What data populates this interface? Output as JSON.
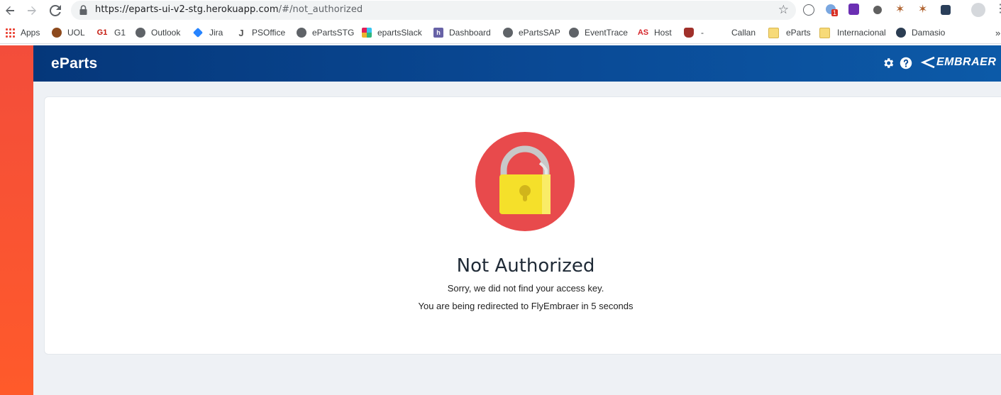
{
  "browser": {
    "url_host": "https://eparts-ui-v2-stg.herokuapp.com",
    "url_path": "/#/not_authorized",
    "bookmarks": [
      {
        "label": "Apps",
        "icon": "apps-grid-icon"
      },
      {
        "label": "UOL",
        "icon": "uol-icon"
      },
      {
        "label": "G1",
        "icon": "g1-icon"
      },
      {
        "label": "Outlook",
        "icon": "globe-icon"
      },
      {
        "label": "Jira",
        "icon": "jira-icon"
      },
      {
        "label": "PSOffice",
        "icon": "psoffice-icon"
      },
      {
        "label": "ePartsSTG",
        "icon": "globe-icon"
      },
      {
        "label": "epartsSlack",
        "icon": "slack-icon"
      },
      {
        "label": "Dashboard",
        "icon": "heroku-icon"
      },
      {
        "label": "ePartsSAP",
        "icon": "globe-icon"
      },
      {
        "label": "EventTrace",
        "icon": "globe-icon"
      },
      {
        "label": "Host",
        "icon": "as-icon"
      },
      {
        "label": "-",
        "icon": "ruby-icon"
      },
      {
        "label": "Callan",
        "icon": "blank-icon"
      },
      {
        "label": "eParts",
        "icon": "folder-icon"
      },
      {
        "label": "Internacional",
        "icon": "folder-icon"
      },
      {
        "label": "Damasio",
        "icon": "damasio-icon"
      }
    ],
    "more_bookmarks": "»",
    "extension_badge": "1"
  },
  "app": {
    "brand": "eParts",
    "logo_text": "EMBRAER"
  },
  "content": {
    "title": "Not Authorized",
    "message": "Sorry, we did not find your access key.",
    "redirect": "You are being redirected to FlyEmbraer in 5 seconds"
  },
  "colors": {
    "header": "#05377a",
    "lock_circle": "#e84a4c",
    "lock_body": "#f5e02a",
    "accent_bar": "#f34d3b"
  }
}
